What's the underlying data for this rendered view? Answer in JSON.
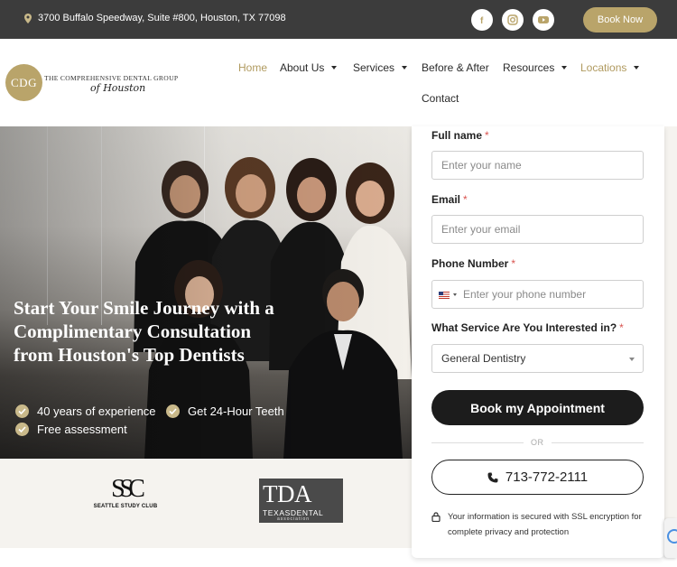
{
  "topbar": {
    "address": "3700 Buffalo Speedway, Suite #800, Houston, TX 77098",
    "social": [
      {
        "name": "facebook-icon",
        "glyph": "f"
      },
      {
        "name": "instagram-icon",
        "glyph": ""
      },
      {
        "name": "youtube-icon",
        "glyph": ""
      }
    ],
    "book_now": "Book Now"
  },
  "header": {
    "logo": {
      "monogram": "CDG",
      "line1": "THE COMPREHENSIVE DENTAL GROUP",
      "script": "of Houston"
    },
    "nav": [
      {
        "label": "Home",
        "active": true,
        "dropdown": false
      },
      {
        "label": "About Us",
        "active": false,
        "dropdown": true
      },
      {
        "label": "Services",
        "active": false,
        "dropdown": true
      },
      {
        "label": "Before & After",
        "active": false,
        "dropdown": false
      },
      {
        "label": "Resources",
        "active": false,
        "dropdown": true
      },
      {
        "label": "Locations",
        "active": true,
        "dropdown": true
      },
      {
        "label": "Contact",
        "active": false,
        "dropdown": false
      }
    ]
  },
  "hero": {
    "title": "Start Your Smile Journey with a Complimentary Consultation from Houston's Top Dentists",
    "checks": [
      "40 years of experience",
      "Get 24-Hour Teeth",
      "Free assessment"
    ]
  },
  "form": {
    "full_name_label": "Full name",
    "full_name_placeholder": "Enter your name",
    "email_label": "Email",
    "email_placeholder": "Enter your email",
    "phone_label": "Phone Number",
    "phone_placeholder": "Enter your phone number",
    "service_label": "What Service Are You Interested in?",
    "service_value": "General Dentistry",
    "required_mark": "*",
    "submit_label": "Book my Appointment",
    "or_label": "OR",
    "phone_number": "713-772-2111",
    "secure_text": "Your information is secured with SSL encryption for complete privacy and protection"
  },
  "logos": {
    "ssc_mark": "SSC",
    "ssc_name": "SEATTLE STUDY CLUB",
    "tda_big": "TDA",
    "tda_small": "TEXASDENTAL",
    "tda_tiny": "association"
  },
  "colors": {
    "accent": "#b9a46a",
    "topbar": "#3c3c3c",
    "button": "#1c1c1c"
  }
}
